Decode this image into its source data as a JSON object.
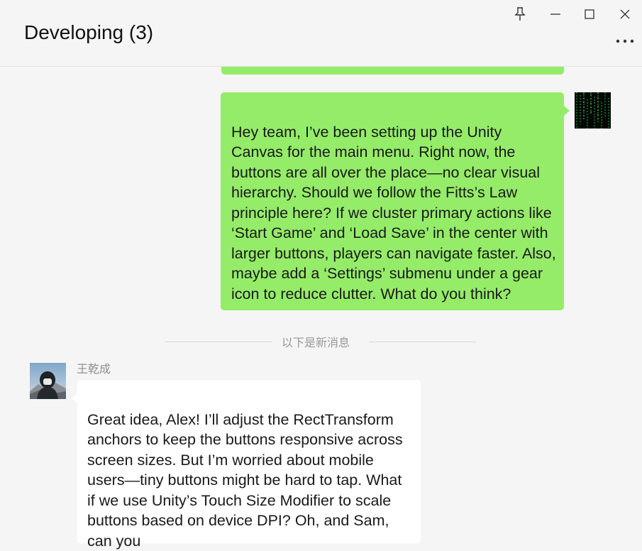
{
  "window": {
    "title": "Developing (3)",
    "controls": [
      "pin-icon",
      "minimize-icon",
      "maximize-icon",
      "close-icon"
    ],
    "more_icon": "more-icon"
  },
  "colors": {
    "my_bubble": "#95ec69",
    "other_bubble": "#ffffff",
    "background": "#f5f5f5"
  },
  "messages": [
    {
      "sender": "me",
      "text": "Hey team, I’ve been setting up the Unity Canvas for the main menu. Right now, the buttons are all over the place—no clear visual hierarchy. Should we follow the Fitts’s Law principle here? If we cluster primary actions like ‘Start Game’ and ‘Load Save’ in the center with larger buttons, players can navigate faster. Also, maybe add a ‘Settings’ submenu under a gear icon to reduce clutter. What do you think?"
    },
    {
      "sender_name": "王乾成",
      "text": "Great idea, Alex! I’ll adjust the RectTransform anchors to keep the buttons responsive across screen sizes. But I’m worried about mobile users—tiny buttons might be hard to tap. What if we use Unity’s Touch Size Modifier to scale buttons based on device DPI? Oh, and Sam, can you"
    }
  ],
  "divider": {
    "label": "以下是新消息"
  }
}
